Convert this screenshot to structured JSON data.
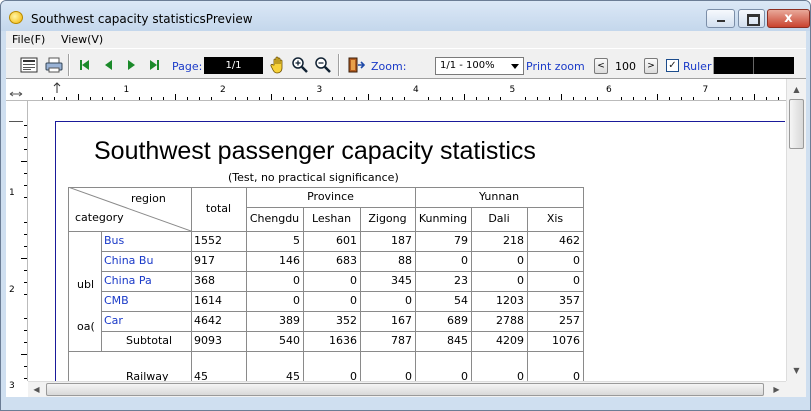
{
  "window": {
    "title": "Southwest capacity statisticsPreview",
    "close_glyph": "x"
  },
  "menu": {
    "items": [
      "File(F)",
      "View(V)"
    ]
  },
  "toolbar": {
    "page_label": "Page:",
    "page_value": "1/1",
    "zoom_label": "Zoom:",
    "zoom_value": "1/1 - 100%",
    "print_zoom_label": "Print zoom",
    "print_zoom_value": "100",
    "spin_left": "<",
    "spin_right": ">",
    "ruler_label": "Ruler",
    "ruler_checked": "✓",
    "icons": [
      "setup-icon",
      "print-icon",
      "first-page-icon",
      "prev-page-icon",
      "next-page-icon",
      "last-page-icon",
      "hand-icon",
      "zoom-in-icon",
      "zoom-out-icon",
      "exit-icon"
    ]
  },
  "ruler": {
    "h_numbers": [
      "1",
      "2",
      "3",
      "4",
      "5",
      "6",
      "7"
    ],
    "v_numbers": [
      "1",
      "2",
      "3"
    ]
  },
  "report": {
    "title": "Southwest passenger capacity statistics",
    "subtitle": "(Test, no practical significance)",
    "header": {
      "region": "region",
      "category": "category",
      "total": "total",
      "groups": [
        "Province",
        "Yunnan"
      ],
      "cities": [
        "Chengdu",
        "Leshan",
        "Zigong",
        "Kunming",
        "Dali",
        "Xis"
      ]
    },
    "group_labels": [
      "ubl",
      "oa("
    ],
    "rows": [
      {
        "name": "Bus",
        "total": "1552",
        "values": [
          "5",
          "601",
          "187",
          "79",
          "218",
          "462"
        ]
      },
      {
        "name": "China Bu",
        "total": "917",
        "values": [
          "146",
          "683",
          "88",
          "0",
          "0",
          "0"
        ]
      },
      {
        "name": "China Pa",
        "total": "368",
        "values": [
          "0",
          "0",
          "345",
          "23",
          "0",
          "0"
        ]
      },
      {
        "name": "CMB",
        "total": "1614",
        "values": [
          "0",
          "0",
          "0",
          "54",
          "1203",
          "357"
        ]
      },
      {
        "name": "Car",
        "total": "4642",
        "values": [
          "389",
          "352",
          "167",
          "689",
          "2788",
          "257"
        ]
      }
    ],
    "subtotal": {
      "name": "Subtotal",
      "total": "9093",
      "values": [
        "540",
        "1636",
        "787",
        "845",
        "4209",
        "1076"
      ]
    },
    "railway": {
      "name": "Railway",
      "total": "45",
      "values": [
        "45",
        "0",
        "0",
        "0",
        "0",
        "0"
      ]
    }
  },
  "colors": {
    "link_blue": "#1a3ac8",
    "titlebar": "#cfdff0"
  }
}
